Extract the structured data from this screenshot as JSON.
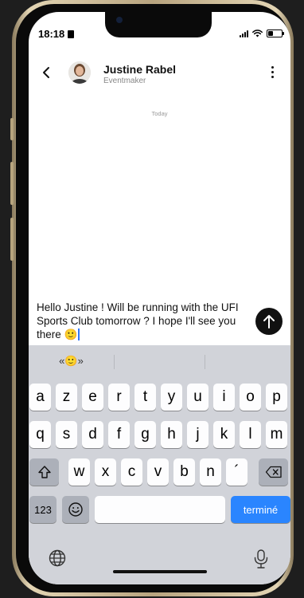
{
  "status_bar": {
    "time": "18:18"
  },
  "header": {
    "contact_name": "Justine Rabel",
    "contact_role": "Eventmaker"
  },
  "chat": {
    "date_label": "Today"
  },
  "composer": {
    "message_text": "Hello Justine ! Will be running with the UFI Sports Club tomorrow ? I hope I'll see you there",
    "emoji": "🙂"
  },
  "keyboard": {
    "suggestion": "«🙂»",
    "rows": [
      [
        "a",
        "z",
        "e",
        "r",
        "t",
        "y",
        "u",
        "i",
        "o",
        "p"
      ],
      [
        "q",
        "s",
        "d",
        "f",
        "g",
        "h",
        "j",
        "k",
        "l",
        "m"
      ],
      [
        "w",
        "x",
        "c",
        "v",
        "b",
        "n",
        "´"
      ]
    ],
    "numbers_label": "123",
    "done_label": "terminé"
  },
  "colors": {
    "accent": "#2a85ff",
    "send_button": "#111111",
    "keyboard_bg": "#d1d3d9"
  }
}
